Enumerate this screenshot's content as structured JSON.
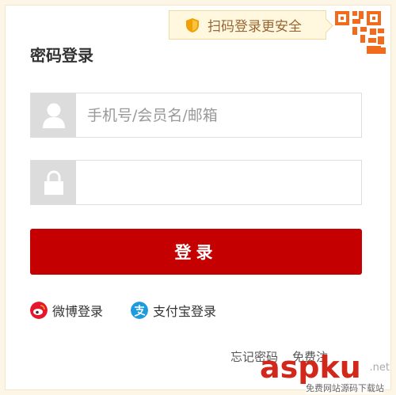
{
  "qr_tip": {
    "text": "扫码登录更安全"
  },
  "login": {
    "title": "密码登录",
    "username_placeholder": "手机号/会员名/邮箱",
    "password_placeholder": "",
    "submit_label": "登录"
  },
  "third_party": {
    "weibo_label": "微博登录",
    "alipay_label": "支付宝登录"
  },
  "links": {
    "forgot_password": "忘记密码",
    "free_register": "免费注"
  },
  "watermark": {
    "main": "aspku",
    "net": ".net",
    "sub": "免费网站源码下载站"
  },
  "colors": {
    "brand_red": "#c40000",
    "qr_orange": "#f26b1d",
    "weibo_red": "#e6162d",
    "alipay_blue": "#1e9bde"
  }
}
